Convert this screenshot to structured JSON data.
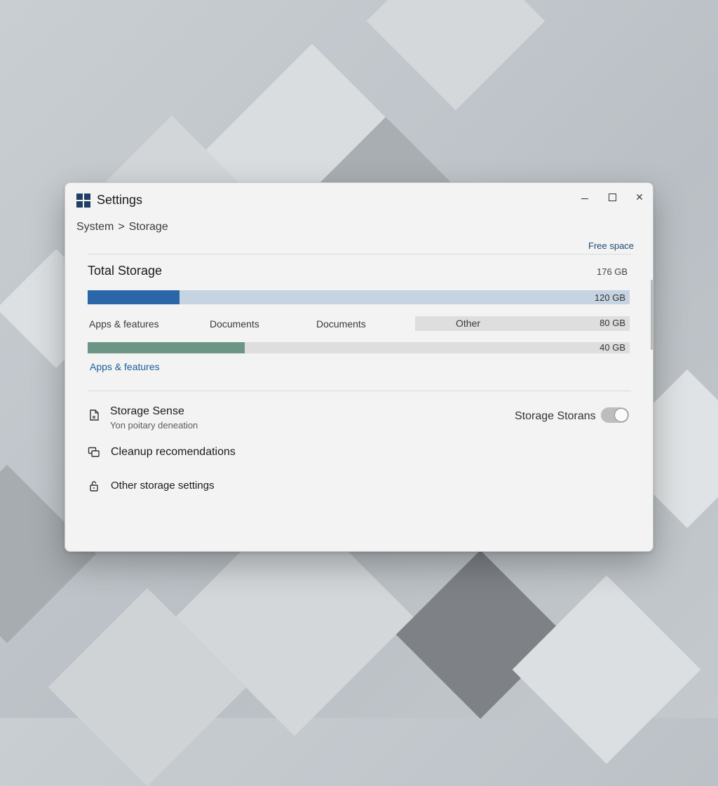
{
  "window": {
    "title": "Settings",
    "controls": {
      "minimize": "minimize",
      "maximize": "maximize",
      "close": "✕"
    }
  },
  "breadcrumb": {
    "parent": "System",
    "separator": ">",
    "current": "Storage"
  },
  "storage": {
    "free_space_label": "Free space",
    "title": "Total Storage",
    "total_value": "176 GB",
    "primary_bar": {
      "label": "120 GB",
      "fill_fraction": 0.17,
      "color": "#2a66a8"
    },
    "categories": [
      "Apps & features",
      "Documents",
      "Documents"
    ],
    "other": {
      "label": "Other",
      "value": "80 GB"
    },
    "secondary_bar": {
      "label": "40 GB",
      "fill_fraction": 0.29,
      "color": "#6c9585"
    },
    "apps_link": "Apps & features"
  },
  "storage_sense": {
    "title": "Storage Sense",
    "subtitle": "Yon poitary deneation",
    "toggle_label": "Storage Storans",
    "toggle_on": false
  },
  "links": {
    "cleanup": "Cleanup recomendations",
    "other_settings": "Other storage settings"
  },
  "icons": {
    "app": "windows-logo-icon",
    "storage_sense": "document-icon",
    "cleanup": "copy-icon",
    "other": "lock-icon"
  }
}
